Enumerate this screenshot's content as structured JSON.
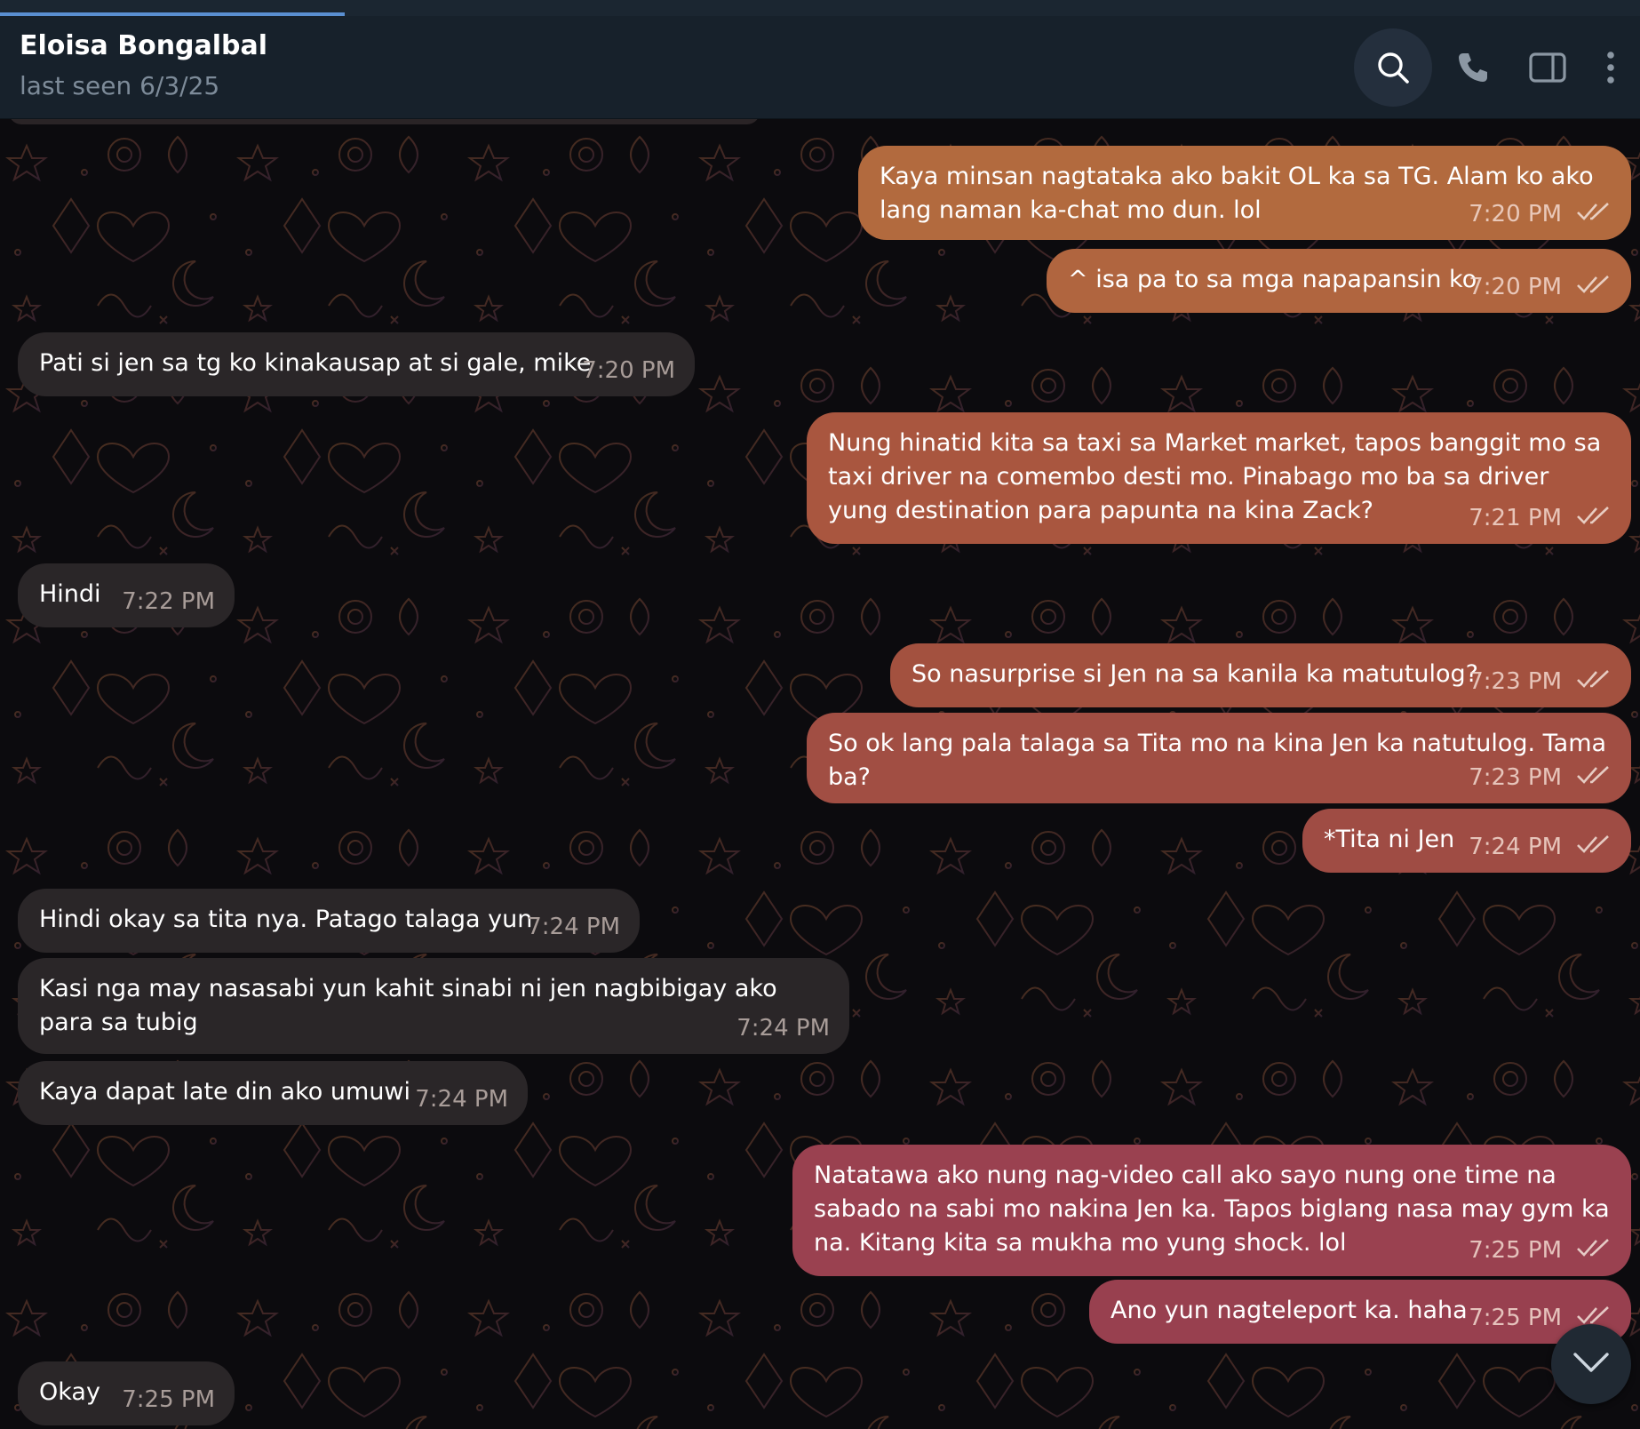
{
  "header": {
    "contact_name": "Eloisa Bongalbal",
    "status": "last seen 6/3/25",
    "icons": [
      "search-icon",
      "phone-icon",
      "sidebar-toggle-icon",
      "more-vertical-icon"
    ]
  },
  "top_strip": {
    "loading_progress": 0.21
  },
  "colors": {
    "header_bg": "#17212b",
    "incoming_bubble": "#2a2628",
    "outgoing_gradient_top": "#b5673d",
    "outgoing_gradient_bottom": "#9a3f4d",
    "accent": "#5a8fd1"
  },
  "messages": [
    {
      "dir": "out",
      "text": "Kaya minsan nagtataka ako bakit OL ka sa TG. Alam ko ako lang naman ka-chat mo dun. lol",
      "time": "7:20 PM",
      "read": true
    },
    {
      "dir": "out",
      "text": "^ isa pa to sa mga napapansin ko",
      "time": "7:20 PM",
      "read": true
    },
    {
      "dir": "in",
      "text": "Pati si jen sa tg ko kinakausap at si gale, mike",
      "time": "7:20 PM"
    },
    {
      "dir": "out",
      "text": "Nung hinatid kita sa taxi sa Market market, tapos banggit mo sa taxi driver na comembo desti mo. Pinabago mo ba sa driver yung destination para papunta na kina Zack?",
      "time": "7:21 PM",
      "read": true
    },
    {
      "dir": "in",
      "text": "Hindi",
      "time": "7:22 PM"
    },
    {
      "dir": "out",
      "text": "So nasurprise si Jen na sa kanila ka matutulog?",
      "time": "7:23 PM",
      "read": true
    },
    {
      "dir": "out",
      "text": "So ok lang pala talaga sa Tita mo na kina Jen ka natutulog. Tama ba?",
      "time": "7:23 PM",
      "read": true
    },
    {
      "dir": "out",
      "text": "*Tita ni Jen",
      "time": "7:24 PM",
      "read": true
    },
    {
      "dir": "in",
      "text": "Hindi okay sa tita nya. Patago talaga yun",
      "time": "7:24 PM"
    },
    {
      "dir": "in",
      "text": "Kasi nga may nasasabi yun kahit sinabi ni jen nagbibigay ako para sa tubig",
      "time": "7:24 PM"
    },
    {
      "dir": "in",
      "text": "Kaya dapat late din ako umuwi",
      "time": "7:24 PM"
    },
    {
      "dir": "out",
      "text": "Natatawa ako nung nag-video call ako sayo nung one time na sabado na sabi mo nakina Jen ka. Tapos biglang nasa may gym ka na. Kitang kita sa mukha mo yung shock. lol",
      "time": "7:25 PM",
      "read": true
    },
    {
      "dir": "out",
      "text": "Ano yun nagteleport ka. haha",
      "time": "7:25 PM",
      "read": true
    },
    {
      "dir": "in",
      "text": "Okay",
      "time": "7:25 PM"
    }
  ],
  "scroll_down_icon": "chevron-down-icon"
}
